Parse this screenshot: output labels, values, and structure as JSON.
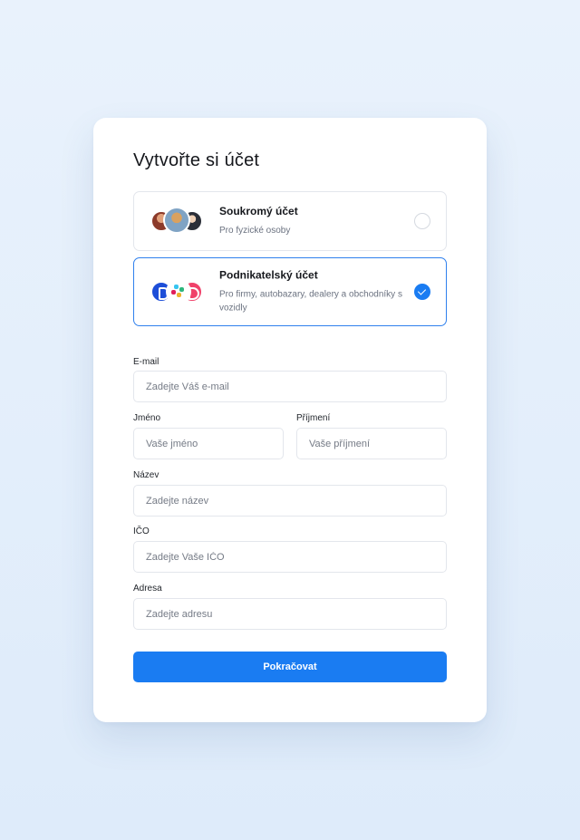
{
  "title": "Vytvořte si účet",
  "account_types": [
    {
      "title": "Soukromý účet",
      "description": "Pro fyzické osoby",
      "selected": false,
      "icon": "user-avatars-icon"
    },
    {
      "title": "Podnikatelský účet",
      "description": "Pro firmy, autobazary, dealery a obchodníky s vozidly",
      "selected": true,
      "icon": "company-logos-icon"
    }
  ],
  "form": {
    "email": {
      "label": "E-mail",
      "placeholder": "Zadejte Váš e-mail",
      "value": ""
    },
    "first_name": {
      "label": "Jméno",
      "placeholder": "Vaše jméno",
      "value": ""
    },
    "last_name": {
      "label": "Příjmení",
      "placeholder": "Vaše příjmení",
      "value": ""
    },
    "company_name": {
      "label": "Název",
      "placeholder": "Zadejte název",
      "value": ""
    },
    "ico": {
      "label": "IČO",
      "placeholder": "Zadejte Vaše IČO",
      "value": ""
    },
    "address": {
      "label": "Adresa",
      "placeholder": "Zadejte adresu",
      "value": ""
    }
  },
  "submit_label": "Pokračovat",
  "colors": {
    "accent": "#1a7cf2",
    "border": "#e3e6ec",
    "selected_border": "#2f80ed"
  }
}
